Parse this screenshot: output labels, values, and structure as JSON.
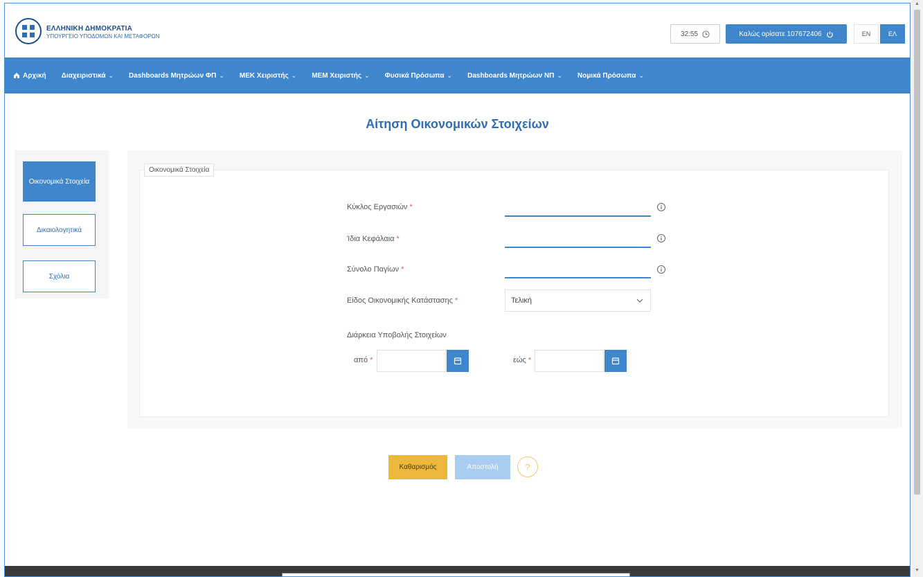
{
  "header": {
    "logo_title": "ΕΛΛΗΝΙΚΗ ΔΗΜΟΚΡΑΤΙΑ",
    "logo_subtitle": "ΥΠΟΥΡΓΕΙΟ ΥΠΟΔΟΜΩΝ ΚΑΙ ΜΕΤΑΦΟΡΩΝ",
    "timer": "32:55",
    "welcome": "Καλώς ορίσατε 107672406",
    "lang_en": "EN",
    "lang_el": "ΕΛ"
  },
  "nav": {
    "items": [
      {
        "label": "Αρχική"
      },
      {
        "label": "Διαχειριστικά"
      },
      {
        "label": "Dashboards Μητρώων ΦΠ"
      },
      {
        "label": "ΜΕΚ Χειριστής"
      },
      {
        "label": "ΜΕΜ Χειριστής"
      },
      {
        "label": "Φυσικά Πρόσωπα"
      },
      {
        "label": "Dashboards Μητρώων ΝΠ"
      },
      {
        "label": "Νομικά Πρόσωπα"
      }
    ]
  },
  "page": {
    "title": "Αίτηση Οικονομικών Στοιχείων"
  },
  "sidebar": {
    "items": [
      {
        "label": "Οικονομικά Στοιχεία"
      },
      {
        "label": "Δικαιολογητικά"
      },
      {
        "label": "Σχόλια"
      }
    ]
  },
  "form": {
    "legend": "Οικονομικά Στοιχεία",
    "turnover_label": "Κύκλος Εργασιών",
    "equity_label": "Ίδια Κεφάλαια",
    "fixed_assets_label": "Σύνολο Παγίων",
    "statement_type_label": "Είδος Οικονομικής Κατάστασης",
    "statement_type_value": "Τελική",
    "period_label": "Διάρκεια Υποβολής Στοιχείων",
    "from_label": "από",
    "to_label": "εώς",
    "required_mark": "*"
  },
  "actions": {
    "clear": "Καθαρισμός",
    "submit": "Αποστολή",
    "help": "?"
  },
  "colors": {
    "primary": "#3f86cc",
    "accent_yellow": "#ecb83b",
    "disabled_blue": "#a9cdf0",
    "title_blue": "#2f6db4"
  }
}
